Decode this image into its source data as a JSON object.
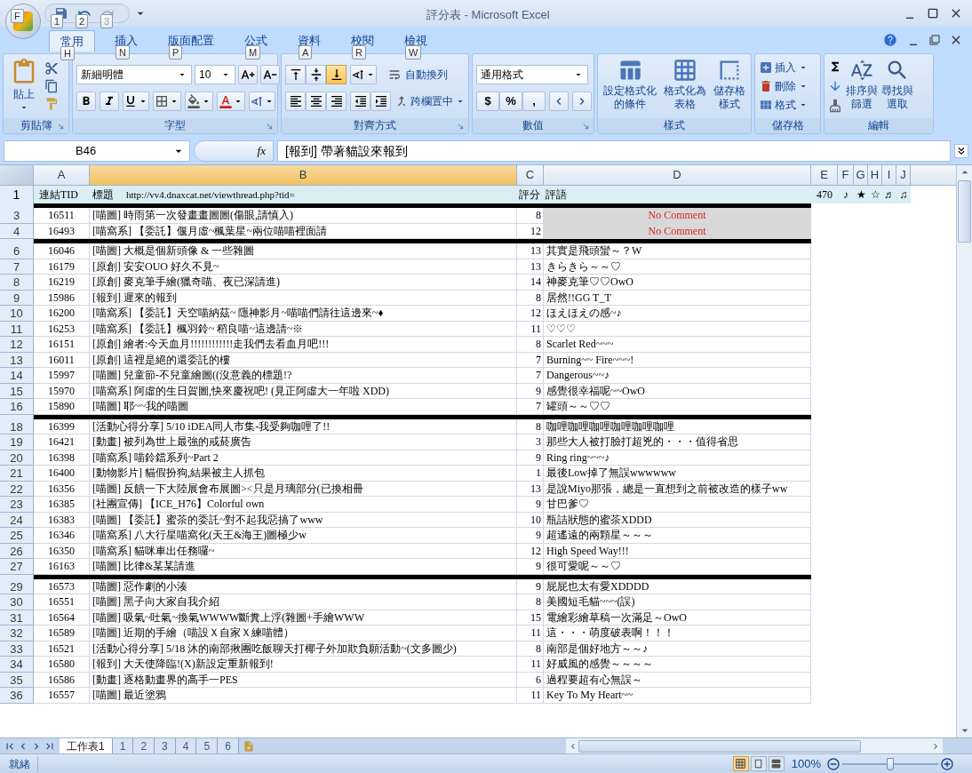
{
  "window": {
    "title": "評分表 - Microsoft Excel"
  },
  "office_button": {
    "keytip": "F"
  },
  "quick_access": [
    {
      "keytip": "1",
      "disabled": false
    },
    {
      "keytip": "2",
      "disabled": false
    },
    {
      "keytip": "3",
      "disabled": true
    }
  ],
  "tabs": [
    {
      "label": "常用",
      "keytip": "H",
      "selected": true
    },
    {
      "label": "插入",
      "keytip": "N",
      "selected": false
    },
    {
      "label": "版面配置",
      "keytip": "P",
      "selected": false
    },
    {
      "label": "公式",
      "keytip": "M",
      "selected": false
    },
    {
      "label": "資料",
      "keytip": "A",
      "selected": false
    },
    {
      "label": "校閱",
      "keytip": "R",
      "selected": false
    },
    {
      "label": "檢視",
      "keytip": "W",
      "selected": false
    }
  ],
  "ribbon": {
    "clipboard": {
      "paste": "貼上",
      "group": "剪貼簿"
    },
    "font": {
      "name": "新細明體",
      "size": "10",
      "group": "字型"
    },
    "alignment": {
      "vertical_align": [
        {
          "kind": "top",
          "selected": false
        },
        {
          "kind": "middle",
          "selected": false
        },
        {
          "kind": "bottom",
          "selected": true
        }
      ],
      "wrap": "自動換列",
      "merge": "跨欄置中",
      "group": "對齊方式"
    },
    "number": {
      "format": "通用格式",
      "symbols": [
        "$",
        "%",
        ","
      ],
      "group": "數值"
    },
    "styles": {
      "buttons": [
        {
          "kind": "conditional",
          "lines": [
            "設定格式化",
            "的條件"
          ]
        },
        {
          "kind": "table",
          "lines": [
            "格式化為",
            "表格"
          ]
        },
        {
          "kind": "cell",
          "lines": [
            "儲存格",
            "樣式"
          ]
        }
      ],
      "group": "樣式"
    },
    "cells": {
      "buttons": [
        {
          "kind": "insert",
          "label": "插入"
        },
        {
          "kind": "delete",
          "label": "刪除"
        },
        {
          "kind": "format",
          "label": "格式"
        }
      ],
      "group": "儲存格"
    },
    "editing": {
      "buttons": [
        {
          "kind": "sort",
          "lines": [
            "排序與",
            "篩選"
          ]
        },
        {
          "kind": "find",
          "lines": [
            "尋找與",
            "選取"
          ]
        }
      ],
      "group": "編輯"
    }
  },
  "formula_bar": {
    "name_box": "B46",
    "fx": "fx",
    "value": "[報到] 帶著貓設來報到"
  },
  "columns": [
    {
      "label": "A",
      "selected": false
    },
    {
      "label": "B",
      "selected": true
    },
    {
      "label": "C",
      "selected": false
    },
    {
      "label": "D",
      "selected": false
    },
    {
      "label": "E",
      "selected": false
    },
    {
      "label": "F",
      "selected": false
    },
    {
      "label": "G",
      "selected": false
    },
    {
      "label": "H",
      "selected": false
    },
    {
      "label": "I",
      "selected": false
    },
    {
      "label": "J",
      "selected": false
    }
  ],
  "header_row": {
    "number": "1",
    "tid": "連結TID",
    "title": "標題",
    "url": "http://vv4.dnaxcat.net/viewthread.php?tid=",
    "score": "評分",
    "comment": "評語",
    "extra": [
      "470",
      "♪",
      "★",
      "☆",
      "♬",
      "♫"
    ]
  },
  "rows": [
    {
      "kind": "divider"
    },
    {
      "kind": "row",
      "number": "3",
      "tid": "16511",
      "title": "[喵圖] 時雨第一次發畫畫圖圖(傷眼,請慎入)",
      "score": "8",
      "comment": "No Comment",
      "shaded": true
    },
    {
      "kind": "row",
      "number": "4",
      "tid": "16493",
      "title": "[喵窩系] 【委託】偃月虛~楓葉星~兩位喵喵裡面請",
      "score": "12",
      "comment": "No Comment",
      "shaded": true
    },
    {
      "kind": "divider"
    },
    {
      "kind": "row",
      "number": "6",
      "tid": "16046",
      "title": "[喵圖] 大概是個新頭像 & 一些雜圖",
      "score": "13",
      "comment": "其實是飛頭蠻～？W",
      "shaded": false
    },
    {
      "kind": "row",
      "number": "7",
      "tid": "16179",
      "title": "[原創] 安安OUO 好久不見~",
      "score": "13",
      "comment": "きらきら～～♡",
      "shaded": false
    },
    {
      "kind": "row",
      "number": "8",
      "tid": "16219",
      "title": "[原創] 麥克筆手繪(獵奇喵、夜已深請進)",
      "score": "14",
      "comment": "神麥克筆♡♡OwO",
      "shaded": false
    },
    {
      "kind": "row",
      "number": "9",
      "tid": "15986",
      "title": "[報到] 遲來的報到",
      "score": "8",
      "comment": "居然!!GG T_T",
      "shaded": false
    },
    {
      "kind": "row",
      "number": "10",
      "tid": "16200",
      "title": "[喵窩系] 【委託】天空喵納茲~ 隱神影月~喵喵們請往這邊來~♦",
      "score": "12",
      "comment": "ほえほえの感~♪",
      "shaded": false
    },
    {
      "kind": "row",
      "number": "11",
      "tid": "16253",
      "title": "[喵窩系] 【委託】楓羽鈴~ 稻良喵~這邊請~※",
      "score": "11",
      "comment": "♡♡♡",
      "shaded": false
    },
    {
      "kind": "row",
      "number": "12",
      "tid": "16151",
      "title": "[原創] 繪者:今天血月!!!!!!!!!!!!走我們去看血月吧!!!",
      "score": "8",
      "comment": "Scarlet Red~~~",
      "shaded": false
    },
    {
      "kind": "row",
      "number": "13",
      "tid": "16011",
      "title": "[原創] 這裡是絕的還委託的樓",
      "score": "7",
      "comment": "Burning~~ Fire~~~!",
      "shaded": false
    },
    {
      "kind": "row",
      "number": "14",
      "tid": "15997",
      "title": "[喵圖] 兒童節-不兒童繪圖((沒意義的標題!?",
      "score": "7",
      "comment": "Dangerous~~♪",
      "shaded": false
    },
    {
      "kind": "row",
      "number": "15",
      "tid": "15970",
      "title": "[喵窩系] 阿虛的生日賀圖,快來慶祝吧! (見正阿虛大一年啦 XDD)",
      "score": "9",
      "comment": "感覺很幸福呢~~OwO",
      "shaded": false
    },
    {
      "kind": "row",
      "number": "16",
      "tid": "15890",
      "title": "[喵圖] 耶~~我的喵圖",
      "score": "7",
      "comment": "罐頭～～♡♡",
      "shaded": false
    },
    {
      "kind": "divider"
    },
    {
      "kind": "row",
      "number": "18",
      "tid": "16399",
      "title": "[活動心得分享] 5/10 iDEA同人市集-我受夠咖哩了!!",
      "score": "8",
      "comment": "咖哩咖哩咖哩咖哩咖哩咖哩",
      "shaded": false
    },
    {
      "kind": "row",
      "number": "19",
      "tid": "16421",
      "title": "[動畫] 被列為世上最強的戒菸廣告",
      "score": "3",
      "comment": "那些大人被打臉打超兇的・・・值得省思",
      "shaded": false
    },
    {
      "kind": "row",
      "number": "20",
      "tid": "16398",
      "title": "[喵窩系] 喵鈴鐺系列~Part 2",
      "score": "9",
      "comment": "Ring ring~~~♪",
      "shaded": false
    },
    {
      "kind": "row",
      "number": "21",
      "tid": "16400",
      "title": "[動物影片] 貓假扮狗,結果被主人抓包",
      "score": "1",
      "comment": "最後Low掉了無誤wwwwww",
      "shaded": false
    },
    {
      "kind": "row",
      "number": "22",
      "tid": "16356",
      "title": "[喵圖] 反饋一下大陸展會布展圖><只是月璃部分(已換相冊",
      "score": "13",
      "comment": "是說Miyo那張，總是一直想到之前被改造的樣子ww",
      "shaded": false
    },
    {
      "kind": "row",
      "number": "23",
      "tid": "16385",
      "title": "[社團宣傳] 【ICE_H76】Colorful own",
      "score": "9",
      "comment": "甘巴爹♡",
      "shaded": false
    },
    {
      "kind": "row",
      "number": "24",
      "tid": "16383",
      "title": "[喵圖] 【委託】蜜茶的委託~對不起我惡搞了www",
      "score": "10",
      "comment": "瓶詰狀態的蜜茶XDDD",
      "shaded": false
    },
    {
      "kind": "row",
      "number": "25",
      "tid": "16346",
      "title": "[喵窩系] 八大行星喵窩化(天王&海王)圖極少w",
      "score": "9",
      "comment": "超遙遠的兩顆星～～～",
      "shaded": false
    },
    {
      "kind": "row",
      "number": "26",
      "tid": "16350",
      "title": "[喵窩系] 貓咪車出任務囉~",
      "score": "12",
      "comment": "High Speed Way!!!",
      "shaded": false
    },
    {
      "kind": "row",
      "number": "27",
      "tid": "16163",
      "title": "[喵圖] 比律&某某請進",
      "score": "9",
      "comment": "很可愛呢～～♡",
      "shaded": false
    },
    {
      "kind": "divider"
    },
    {
      "kind": "row",
      "number": "29",
      "tid": "16573",
      "title": "[喵圖] 惡作劇的小湊",
      "score": "9",
      "comment": "屁屁也太有愛XDDDD",
      "shaded": false
    },
    {
      "kind": "row",
      "number": "30",
      "tid": "16551",
      "title": "[喵圖] 黑子向大家自我介紹",
      "score": "8",
      "comment": "美國短毛貓~~~(誤)",
      "shaded": false
    },
    {
      "kind": "row",
      "number": "31",
      "tid": "16564",
      "title": "[喵圖] 吸氣~吐氣~換氣WWWW斷糞上浮(雜圖+手繪WWW",
      "score": "15",
      "comment": "電繪彩繪草稿一次滿足～OwO",
      "shaded": false
    },
    {
      "kind": "row",
      "number": "32",
      "tid": "16589",
      "title": "[喵圖] 近期的手繪（喵設Ｘ自家Ｘ練喵體）",
      "score": "11",
      "comment": "這・・・萌度破表啊！！！",
      "shaded": false
    },
    {
      "kind": "row",
      "number": "33",
      "tid": "16521",
      "title": "[活動心得分享] 5/18 沐的南部揪團吃飯聊天打椰子外加欺負願活動~(文多圖少)",
      "score": "8",
      "comment": "南部是個好地方～～♪",
      "shaded": false
    },
    {
      "kind": "row",
      "number": "34",
      "tid": "16580",
      "title": "[報到] 大天使降臨!(X)新設定重新報到!",
      "score": "11",
      "comment": "好威風的感覺～～～～",
      "shaded": false
    },
    {
      "kind": "row",
      "number": "35",
      "tid": "16586",
      "title": "[動畫] 逐格動畫界的高手一PES",
      "score": "6",
      "comment": "過程要超有心無誤～",
      "shaded": false
    },
    {
      "kind": "row",
      "number": "36",
      "tid": "16557",
      "title": "[喵圖] 最近塗鴉",
      "score": "11",
      "comment": "Key To My Heart~~",
      "shaded": false
    }
  ],
  "sheet_tabs": [
    {
      "label": "工作表1",
      "selected": true
    },
    {
      "label": "1",
      "selected": false
    },
    {
      "label": "2",
      "selected": false
    },
    {
      "label": "3",
      "selected": false
    },
    {
      "label": "4",
      "selected": false
    },
    {
      "label": "5",
      "selected": false
    },
    {
      "label": "6",
      "selected": false
    }
  ],
  "status_bar": {
    "status": "就緒",
    "views": [
      {
        "kind": "normal",
        "selected": true
      },
      {
        "kind": "layout",
        "selected": false
      },
      {
        "kind": "break",
        "selected": false
      }
    ],
    "zoom": {
      "label": "100%",
      "level": 0.5
    }
  }
}
